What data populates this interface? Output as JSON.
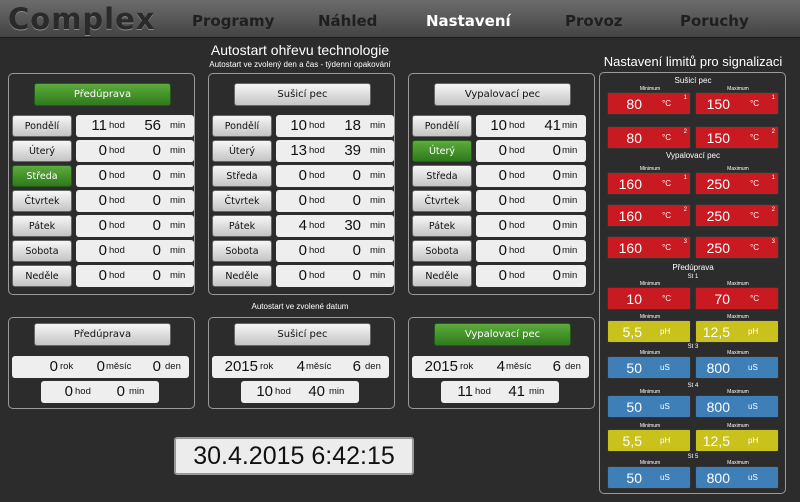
{
  "header": {
    "logo": "Complex",
    "nav": [
      "Programy",
      "Náhled",
      "Nastavení",
      "Provoz",
      "Poruchy"
    ]
  },
  "autostart": {
    "title": "Autostart ohřevu technologie",
    "subtitle": "Autostart ve zvolený den a čas - týdenní opakování",
    "date_subtitle": "Autostart ve zvolené datum"
  },
  "units": {
    "hod": "hod",
    "min": "min",
    "rok": "rok",
    "mesic": "měsíc",
    "den": "den"
  },
  "days": [
    "Pondělí",
    "Úterý",
    "Středa",
    "Čtvrtek",
    "Pátek",
    "Sobota",
    "Neděle"
  ],
  "weekly": [
    {
      "button": "Předúprava",
      "active": true,
      "active_day": 2,
      "rows": [
        [
          "11",
          "56"
        ],
        [
          "0",
          "0"
        ],
        [
          "0",
          "0"
        ],
        [
          "0",
          "0"
        ],
        [
          "0",
          "0"
        ],
        [
          "0",
          "0"
        ],
        [
          "0",
          "0"
        ]
      ]
    },
    {
      "button": "Sušicí pec",
      "active": false,
      "active_day": -1,
      "rows": [
        [
          "10",
          "18"
        ],
        [
          "13",
          "39"
        ],
        [
          "0",
          "0"
        ],
        [
          "0",
          "0"
        ],
        [
          "4",
          "30"
        ],
        [
          "0",
          "0"
        ],
        [
          "0",
          "0"
        ]
      ]
    },
    {
      "button": "Vypalovací pec",
      "active": false,
      "active_day": 1,
      "rows": [
        [
          "10",
          "41"
        ],
        [
          "0",
          "0"
        ],
        [
          "0",
          "0"
        ],
        [
          "0",
          "0"
        ],
        [
          "0",
          "0"
        ],
        [
          "0",
          "0"
        ],
        [
          "0",
          "0"
        ]
      ]
    }
  ],
  "dated": [
    {
      "button": "Předúprava",
      "active": false,
      "rok": "0",
      "mesic": "0",
      "den": "0",
      "hod": "0",
      "min": "0"
    },
    {
      "button": "Sušicí pec",
      "active": false,
      "rok": "2015",
      "mesic": "4",
      "den": "6",
      "hod": "10",
      "min": "40"
    },
    {
      "button": "Vypalovací pec",
      "active": true,
      "rok": "2015",
      "mesic": "4",
      "den": "6",
      "hod": "11",
      "min": "41"
    }
  ],
  "clock": "30.4.2015 6:42:15",
  "limits": {
    "title": "Nastavení limitů pro signalizaci",
    "min_label": "Minimum",
    "max_label": "Maximum",
    "colors": {
      "red": "#c91a22",
      "yellow": "#c9c21c",
      "blue": "#3f7fb8"
    },
    "groups": [
      {
        "header": "Sušicí pec",
        "rows": [
          {
            "min": "80",
            "max": "150",
            "unit": "°C",
            "idx": "1",
            "color": "red",
            "labels": true
          },
          {
            "min": "80",
            "max": "150",
            "unit": "°C",
            "idx": "2",
            "color": "red",
            "labels": false
          }
        ]
      },
      {
        "header": "Vypalovací pec",
        "rows": [
          {
            "min": "160",
            "max": "250",
            "unit": "°C",
            "idx": "1",
            "color": "red",
            "labels": true
          },
          {
            "min": "160",
            "max": "250",
            "unit": "°C",
            "idx": "2",
            "color": "red",
            "labels": false
          },
          {
            "min": "160",
            "max": "250",
            "unit": "°C",
            "idx": "3",
            "color": "red",
            "labels": false
          }
        ]
      },
      {
        "header": "Předúprava",
        "sub": "St 1",
        "rows": [
          {
            "min": "10",
            "max": "70",
            "unit": "°C",
            "idx": "",
            "color": "red",
            "labels": true
          },
          {
            "min": "5,5",
            "max": "12,5",
            "unit": "pH",
            "idx": "",
            "color": "yellow",
            "labels": true
          },
          {
            "min": "50",
            "max": "800",
            "unit": "uS",
            "idx": "",
            "color": "blue",
            "labels": true,
            "sub": "St 3"
          },
          {
            "min": "50",
            "max": "800",
            "unit": "uS",
            "idx": "",
            "color": "blue",
            "labels": true,
            "sub": "St 4"
          },
          {
            "min": "5,5",
            "max": "12,5",
            "unit": "pH",
            "idx": "",
            "color": "yellow",
            "labels": true
          },
          {
            "min": "50",
            "max": "800",
            "unit": "uS",
            "idx": "",
            "color": "blue",
            "labels": true,
            "sub": "St 5"
          }
        ]
      }
    ]
  }
}
